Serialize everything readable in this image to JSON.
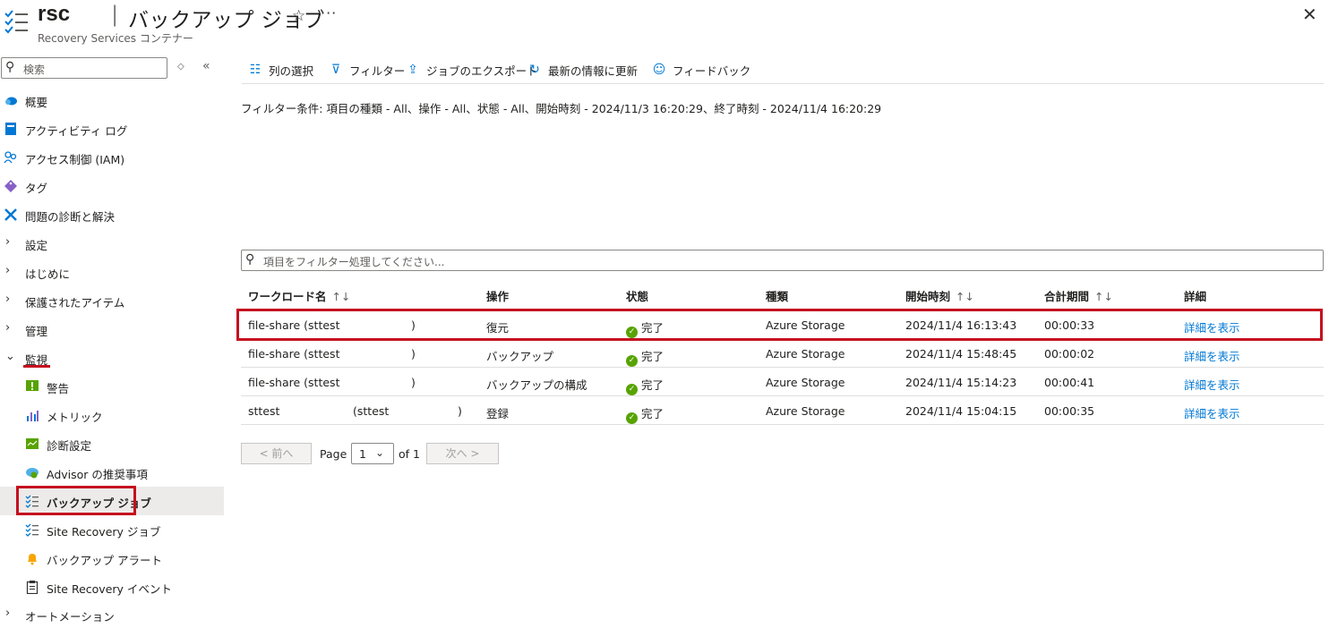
{
  "header": {
    "resource_name": "rsc",
    "separator": "|",
    "page_title": "バックアップ ジョブ",
    "subtitle": "Recovery Services コンテナー",
    "star": "☆",
    "more": "···",
    "close": "✕"
  },
  "sidebar": {
    "search_placeholder": "検索",
    "items": [
      {
        "label": "概要",
        "icon": "cloud-overview-icon"
      },
      {
        "label": "アクティビティ ログ",
        "icon": "activity-log-icon"
      },
      {
        "label": "アクセス制御 (IAM)",
        "icon": "people-iam-icon"
      },
      {
        "label": "タグ",
        "icon": "tag-icon"
      },
      {
        "label": "問題の診断と解決",
        "icon": "wrench-icon"
      },
      {
        "label": "設定",
        "expandable": true
      },
      {
        "label": "はじめに",
        "expandable": true
      },
      {
        "label": "保護されたアイテム",
        "expandable": true
      },
      {
        "label": "管理",
        "expandable": true
      },
      {
        "label": "監視",
        "expandable": true,
        "expanded": true
      },
      {
        "label": "警告",
        "icon": "alert-icon"
      },
      {
        "label": "メトリック",
        "icon": "metrics-icon"
      },
      {
        "label": "診断設定",
        "icon": "diagnostic-settings-icon"
      },
      {
        "label": "Advisor の推奨事項",
        "icon": "advisor-icon"
      },
      {
        "label": "バックアップ ジョブ",
        "icon": "backup-jobs-icon",
        "active": true
      },
      {
        "label": "Site Recovery ジョブ",
        "icon": "site-recovery-jobs-icon"
      },
      {
        "label": "バックアップ アラート",
        "icon": "bell-icon"
      },
      {
        "label": "Site Recovery イベント",
        "icon": "clipboard-icon"
      },
      {
        "label": "オートメーション",
        "expandable": true
      }
    ]
  },
  "toolbar": {
    "columns": "列の選択",
    "filter": "フィルター",
    "export": "ジョブのエクスポート",
    "refresh": "最新の情報に更新",
    "feedback": "フィードバック"
  },
  "filter_condition": "フィルター条件: 項目の種類 - All、操作 - All、状態 - All、開始時刻 - 2024/11/3 16:20:29、終了時刻 - 2024/11/4 16:20:29",
  "filter_placeholder": "項目をフィルター処理してください...",
  "table": {
    "headers": {
      "workload": "ワークロード名",
      "operation": "操作",
      "status": "状態",
      "type": "種類",
      "start": "開始時刻",
      "duration": "合計期間",
      "details": "詳細"
    },
    "sort_glyph": "↑↓",
    "rows": [
      {
        "workload_a": "file-share (sttest",
        "workload_b": ")",
        "operation": "復元",
        "status": "完了",
        "type": "Azure Storage",
        "start": "2024/11/4 16:13:43",
        "duration": "00:00:33",
        "details": "詳細を表示"
      },
      {
        "workload_a": "file-share (sttest",
        "workload_b": ")",
        "operation": "バックアップ",
        "status": "完了",
        "type": "Azure Storage",
        "start": "2024/11/4 15:48:45",
        "duration": "00:00:02",
        "details": "詳細を表示"
      },
      {
        "workload_a": "file-share (sttest",
        "workload_b": ")",
        "operation": "バックアップの構成",
        "status": "完了",
        "type": "Azure Storage",
        "start": "2024/11/4 15:14:23",
        "duration": "00:00:41",
        "details": "詳細を表示"
      },
      {
        "workload_a": "sttest",
        "workload_mid": "(sttest",
        "workload_b": ")",
        "operation": "登録",
        "status": "完了",
        "type": "Azure Storage",
        "start": "2024/11/4 15:04:15",
        "duration": "00:00:35",
        "details": "詳細を表示"
      }
    ]
  },
  "pager": {
    "prev": "< 前へ",
    "page_label": "Page",
    "page_value": "1",
    "of_label": "of 1",
    "next": "次へ >"
  },
  "colors": {
    "accent": "#0078d4",
    "highlight": "#c50f1f",
    "success": "#57a300"
  }
}
